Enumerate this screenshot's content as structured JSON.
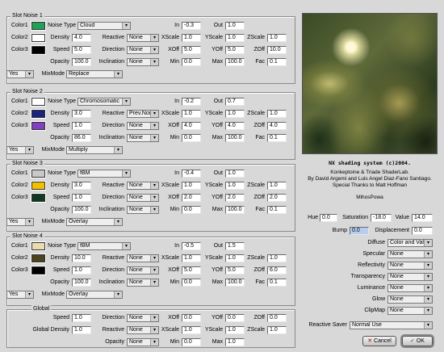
{
  "slots": [
    {
      "title": "Slot Noise 1",
      "labels": {
        "color1": "Color1",
        "color2": "Color2",
        "color3": "Color3",
        "noise_type": "Noise Type",
        "density": "Density",
        "speed": "Speed",
        "opacity": "Opacity",
        "reactive": "Reactive",
        "direction": "Direction",
        "inclination": "Inclination",
        "mixmode": "MixMode",
        "in": "In",
        "out": "Out",
        "xscale": "XScale",
        "yscale": "YScale",
        "zscale": "ZScale",
        "xoff": "XOff",
        "yoff": "YOff",
        "zoff": "ZOff",
        "min": "Min",
        "max": "Max",
        "fac": "Fac"
      },
      "colors": [
        "#22a05a",
        "#ffffff",
        "#000000"
      ],
      "noise_type": "Cloud",
      "density": "4.0",
      "speed": "5.0",
      "opacity": "100.0",
      "reactive": "None",
      "direction": "None",
      "inclination": "None",
      "enabled": "Yes",
      "mixmode": "Replace",
      "in": "-0.3",
      "out": "1.0",
      "xscale": "1.0",
      "yscale": "1.0",
      "zscale": "1.0",
      "xoff": "5.0",
      "yoff": "5.0",
      "zoff": "10.0",
      "min": "0.0",
      "max": "100.0",
      "fac": "0.1"
    },
    {
      "title": "Slot Noise 2",
      "labels": {
        "color1": "Color1",
        "color2": "Color2",
        "color3": "Color3",
        "noise_type": "Noise Type",
        "density": "Density",
        "speed": "Speed",
        "opacity": "Opacity",
        "reactive": "Reactive",
        "direction": "Direction",
        "inclination": "Inclination",
        "mixmode": "MixMode",
        "in": "In",
        "out": "Out",
        "xscale": "XScale",
        "yscale": "YScale",
        "zscale": "ZScale",
        "xoff": "XOff",
        "yoff": "YOff",
        "zoff": "ZOff",
        "min": "Min",
        "max": "Max",
        "fac": "Fac"
      },
      "colors": [
        "#ffffff",
        "#1a237e",
        "#8040c0"
      ],
      "noise_type": "Chromosomatic",
      "density": "3.0",
      "speed": "1.0",
      "opacity": "86.0",
      "reactive": "Prev.Nois...",
      "direction": "None",
      "inclination": "None",
      "enabled": "Yes",
      "mixmode": "Multiply",
      "in": "-0.2",
      "out": "0.7",
      "xscale": "1.0",
      "yscale": "1.0",
      "zscale": "1.0",
      "xoff": "4.0",
      "yoff": "4.0",
      "zoff": "4.0",
      "min": "0.0",
      "max": "100.0",
      "fac": "0.1"
    },
    {
      "title": "Slot Noise 3",
      "labels": {
        "color1": "Color1",
        "color2": "Color2",
        "color3": "Color3",
        "noise_type": "Noise Type",
        "density": "Density",
        "speed": "Speed",
        "opacity": "Opacity",
        "reactive": "Reactive",
        "direction": "Direction",
        "inclination": "Inclination",
        "mixmode": "MixMode",
        "in": "In",
        "out": "Out",
        "xscale": "XScale",
        "yscale": "YScale",
        "zscale": "ZScale",
        "xoff": "XOff",
        "yoff": "YOff",
        "zoff": "ZOff",
        "min": "Min",
        "max": "Max",
        "fac": "Fac"
      },
      "colors": [
        "#c8c8c8",
        "#f0c000",
        "#0e3a22"
      ],
      "noise_type": "fBM",
      "density": "3.0",
      "speed": "1.0",
      "opacity": "100.0",
      "reactive": "None",
      "direction": "None",
      "inclination": "None",
      "enabled": "Yes",
      "mixmode": "Overlay",
      "in": "-0.4",
      "out": "1.0",
      "xscale": "1.0",
      "yscale": "1.0",
      "zscale": "1.0",
      "xoff": "2.0",
      "yoff": "2.0",
      "zoff": "2.0",
      "min": "0.0",
      "max": "100.0",
      "fac": "0.1"
    },
    {
      "title": "Slot Noise 4",
      "labels": {
        "color1": "Color1",
        "color2": "Color2",
        "color3": "Color3",
        "noise_type": "Noise Type",
        "density": "Density",
        "speed": "Speed",
        "opacity": "Opacity",
        "reactive": "Reactive",
        "direction": "Direction",
        "inclination": "Inclination",
        "mixmode": "MixMode",
        "in": "In",
        "out": "Out",
        "xscale": "XScale",
        "yscale": "YScale",
        "zscale": "ZScale",
        "xoff": "XOff",
        "yoff": "YOff",
        "zoff": "ZOff",
        "min": "Min",
        "max": "Max",
        "fac": "Fac"
      },
      "colors": [
        "#e8dcb0",
        "#4a4420",
        "#000000"
      ],
      "noise_type": "fBM",
      "density": "10.0",
      "speed": "1.0",
      "opacity": "100.0",
      "reactive": "None",
      "direction": "None",
      "inclination": "None",
      "enabled": "Yes",
      "mixmode": "Overlay",
      "in": "-0.5",
      "out": "1.5",
      "xscale": "1.0",
      "yscale": "1.0",
      "zscale": "1.0",
      "xoff": "5.0",
      "yoff": "5.0",
      "zoff": "6.0",
      "min": "0.0",
      "max": "100.0",
      "fac": "0.1"
    }
  ],
  "global": {
    "title": "Global",
    "labels": {
      "speed": "Speed",
      "global_density": "Global Density",
      "direction": "Direction",
      "reactive": "Reactive",
      "opacity": "Opacity",
      "xoff": "XOff",
      "yoff": "YOff",
      "zoff": "ZOff",
      "xscale": "XScale",
      "yscale": "YScale",
      "zscale": "ZScale",
      "min": "Min",
      "max": "Max"
    },
    "speed": "1.0",
    "global_density": "1.0",
    "direction": "None",
    "reactive": "None",
    "opacity": "None",
    "xoff": "0.0",
    "yoff": "0.0",
    "zoff": "0.0",
    "xscale": "1.0",
    "yscale": "1.0",
    "zscale": "1.0",
    "min": "0.0",
    "max": "1.0"
  },
  "credits": {
    "title": "NX shading system (c)2004.",
    "line1": "Konkeptoine & Triade ShaderLab.",
    "line2": "By David Argemi and Luis Angel Diaz-Fano Santiago.",
    "line3": "Special Thanks to Matt Hoffman",
    "user": "MihosPowa"
  },
  "shading": {
    "labels": {
      "hue": "Hue",
      "saturation": "Saturation",
      "value": "Value",
      "bump": "Bump",
      "displacement": "Displacement",
      "diffuse": "Diffuse",
      "specular": "Specular",
      "reflectivity": "Reflectivity",
      "transparency": "Transparency",
      "luminance": "Luminance",
      "glow": "Glow",
      "clipmap": "ClipMap",
      "reactive_saver": "Reactive Saver"
    },
    "hue": "0.0",
    "saturation": "-18.0",
    "value": "14.0",
    "bump": "0.0",
    "displacement": "0.0",
    "diffuse": "Color and Value",
    "specular": "None",
    "reflectivity": "None",
    "transparency": "None",
    "luminance": "None",
    "glow": "None",
    "clipmap": "None",
    "reactive_saver": "Normal Use"
  },
  "buttons": {
    "cancel": "Cancel",
    "ok": "OK"
  },
  "icons": {
    "dropdown": "▾",
    "cancel": "✕",
    "ok": "✓"
  }
}
